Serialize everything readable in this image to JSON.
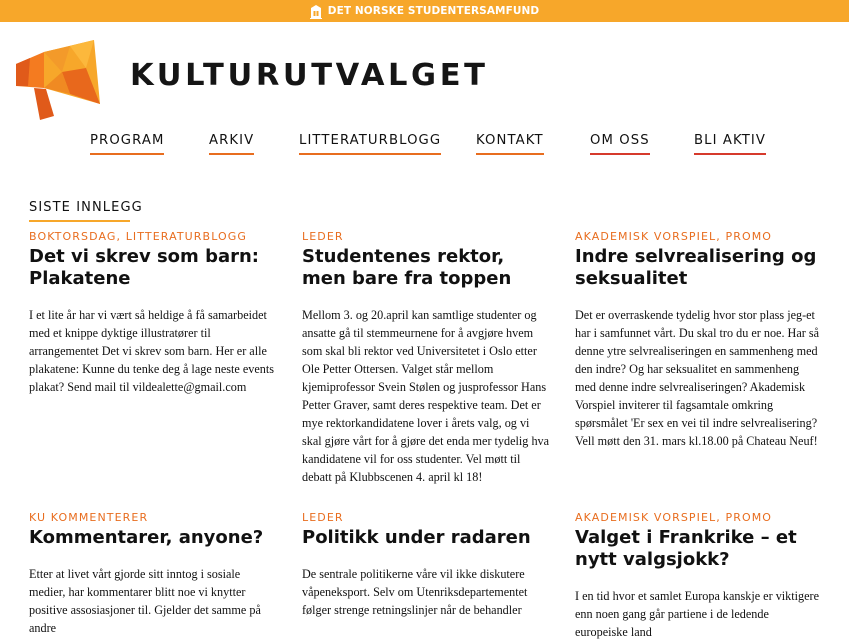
{
  "topbar": {
    "label": "DET NORSKE STUDENTERSAMFUND",
    "icon": "building-icon"
  },
  "brand": {
    "name": "KULTURUTVALGET",
    "logo": "megaphone-logo"
  },
  "nav": [
    {
      "label": "PROGRAM"
    },
    {
      "label": "ARKIV"
    },
    {
      "label": "LITTERATURBLOGG"
    },
    {
      "label": "KONTAKT"
    },
    {
      "label": "OM OSS"
    },
    {
      "label": "BLI AKTIV"
    }
  ],
  "section": {
    "title": "SISTE INNLEGG"
  },
  "posts": [
    {
      "category": "BOKTORSDAG, LITTERATURBLOGG",
      "title": "Det vi skrev som barn: Plakatene",
      "excerpt": "I et lite år har vi vært så heldige å få samarbeidet med et knippe dyktige illustratører til arrangementet Det vi skrev som barn.  Her er alle plakatene: Kunne du tenke deg å lage neste events plakat? Send mail til vildealette@gmail.com"
    },
    {
      "category": "LEDER",
      "title": "Studentenes rektor, men bare fra toppen",
      "excerpt": "Mellom 3. og 20.april kan samtlige studenter og ansatte gå til stemmeurnene for å avgjøre hvem som skal bli rektor ved Universitetet i Oslo etter Ole Petter Ottersen. Valget står mellom kjemiprofessor Svein Stølen og jusprofessor Hans Petter Graver, samt deres respektive team. Det er mye rektorkandidatene lover i årets valg, og vi skal gjøre vårt for å gjøre det enda mer tydelig hva kandidatene vil for oss studenter. Vel møtt til debatt på Klubbscenen 4. april kl 18!"
    },
    {
      "category": "AKADEMISK VORSPIEL, PROMO",
      "title": "Indre selvrealisering og seksualitet",
      "excerpt": "Det er overraskende tydelig hvor stor plass jeg-et har i samfunnet vårt. Du skal tro du er noe. Har så denne ytre selvrealiseringen en sammenheng med den indre? Og har seksualitet en sammenheng med denne indre selvrealiseringen? Akademisk Vorspiel inviterer til fagsamtale omkring spørsmålet 'Er sex en vei til indre selvrealisering? Vell møtt den 31. mars kl.18.00 på Chateau Neuf!"
    },
    {
      "category": "KU KOMMENTERER",
      "title": "Kommentarer, anyone?",
      "excerpt": "Etter at livet vårt gjorde sitt inntog i sosiale medier, har kommentarer blitt noe vi knytter positive assosiasjoner til. Gjelder det samme på andre"
    },
    {
      "category": "LEDER",
      "title": "Politikk under radaren",
      "excerpt": "De sentrale politikerne våre vil ikke diskutere våpeneksport. Selv om Utenriksdepartementet følger strenge retningslinjer når de behandler"
    },
    {
      "category": "AKADEMISK VORSPIEL, PROMO",
      "title": "Valget i Frankrike – et nytt valgsjokk?",
      "excerpt": "I en tid hvor et samlet Europa kanskje er viktigere enn noen gang går partiene i de ledende europeiske land"
    }
  ],
  "colors": {
    "topbar": "#f7a72a",
    "accent": "#e86d1f",
    "accent_red": "#d63a2c",
    "text": "#111111"
  }
}
